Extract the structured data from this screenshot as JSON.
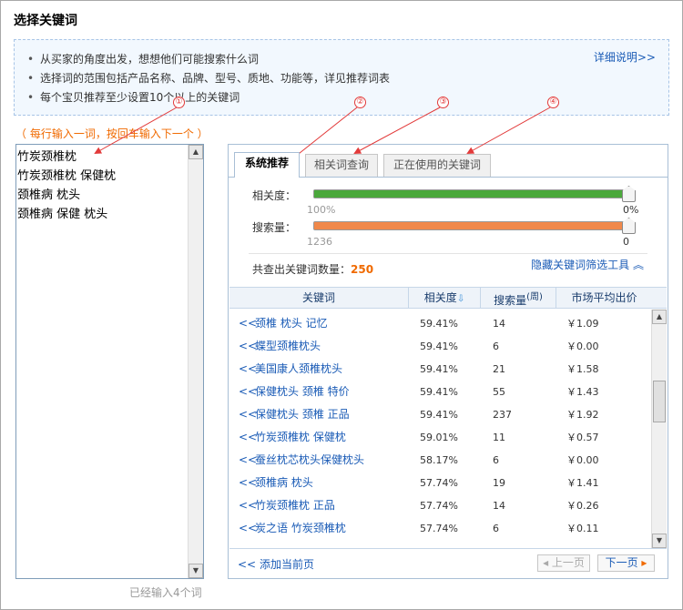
{
  "page": {
    "title": "选择关键词"
  },
  "tips": {
    "items": [
      "从买家的角度出发，想想他们可能搜索什么词",
      "选择词的范围包括产品名称、品牌、型号、质地、功能等，详见推荐词表",
      "每个宝贝推荐至少设置10个以上的关键词"
    ],
    "detail_link": "详细说明>>"
  },
  "input_area": {
    "hint": "（ 每行输入一词，按回车输入下一个 ）",
    "lines": [
      "竹炭颈椎枕",
      "竹炭颈椎枕 保健枕",
      "颈椎病 枕头",
      "颈椎病 保健 枕头"
    ],
    "count_note": "已经输入4个词"
  },
  "tabs": [
    {
      "label": "系统推荐",
      "active": true
    },
    {
      "label": "相关词查询",
      "active": false
    },
    {
      "label": "正在使用的关键词",
      "active": false
    }
  ],
  "filters": {
    "relevance": {
      "label": "相关度：",
      "min": "100%",
      "max": "0%",
      "color": "#4aa83b",
      "level": 1.0
    },
    "search_volume": {
      "label": "搜索量：",
      "min": "1236",
      "max": "0",
      "color": "#f0884a",
      "level": 1.0
    }
  },
  "result": {
    "label": "共查出关键词数量：",
    "count": "250",
    "hide_filter": "隐藏关键词筛选工具 ︽"
  },
  "table": {
    "headers": {
      "keyword": "关键词",
      "relevance": "相关度",
      "volume": "搜索量",
      "volume_unit": "(周)",
      "price": "市场平均出价"
    },
    "add_glyph": "<<",
    "rows": [
      {
        "keyword": "颈椎 枕头 记忆",
        "relevance": "59.41%",
        "volume": "14",
        "price": "￥1.09"
      },
      {
        "keyword": "蝶型颈椎枕头",
        "relevance": "59.41%",
        "volume": "6",
        "price": "￥0.00"
      },
      {
        "keyword": "美国康人颈椎枕头",
        "relevance": "59.41%",
        "volume": "21",
        "price": "￥1.58"
      },
      {
        "keyword": "保健枕头 颈椎 特价",
        "relevance": "59.41%",
        "volume": "55",
        "price": "￥1.43"
      },
      {
        "keyword": "保健枕头 颈椎 正品",
        "relevance": "59.41%",
        "volume": "237",
        "price": "￥1.92"
      },
      {
        "keyword": "竹炭颈椎枕 保健枕",
        "relevance": "59.01%",
        "volume": "11",
        "price": "￥0.57"
      },
      {
        "keyword": "蚕丝枕芯枕头保健枕头",
        "relevance": "58.17%",
        "volume": "6",
        "price": "￥0.00"
      },
      {
        "keyword": "颈椎病 枕头",
        "relevance": "57.74%",
        "volume": "19",
        "price": "￥1.41"
      },
      {
        "keyword": "竹炭颈椎枕 正品",
        "relevance": "57.74%",
        "volume": "14",
        "price": "￥0.26"
      },
      {
        "keyword": "炭之语 竹炭颈椎枕",
        "relevance": "57.74%",
        "volume": "6",
        "price": "￥0.11"
      }
    ]
  },
  "footer": {
    "add_page": "添加当前页",
    "prev": "上一页",
    "next": "下一页",
    "prev_glyph": "◂",
    "next_glyph": "▸"
  },
  "markers": [
    "①",
    "②",
    "③",
    "④"
  ],
  "colors": {
    "accent_orange": "#f06a00",
    "link_blue": "#1a5bb6",
    "annotation_red": "#e23a3a"
  }
}
